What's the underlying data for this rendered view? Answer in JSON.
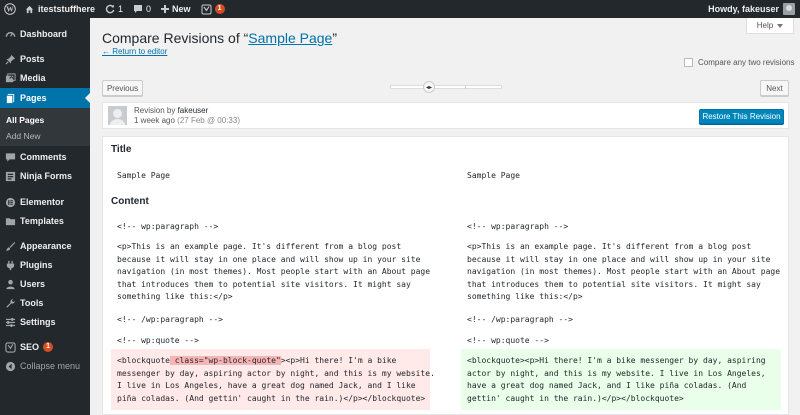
{
  "adminbar": {
    "site_name": "iteststuffhere",
    "updates_count": "1",
    "comments_count": "0",
    "new_label": "New",
    "plugin_badge": "1",
    "howdy": "Howdy, fakeuser"
  },
  "sidebar": {
    "items": [
      {
        "label": "Dashboard",
        "icon": "gauge-icon"
      },
      {
        "label": "Posts",
        "icon": "pin-icon"
      },
      {
        "label": "Media",
        "icon": "media-icon"
      },
      {
        "label": "Pages",
        "icon": "page-icon"
      },
      {
        "label": "Comments",
        "icon": "comment-icon"
      },
      {
        "label": "Ninja Forms",
        "icon": "forms-icon"
      },
      {
        "label": "Elementor",
        "icon": "elementor-icon"
      },
      {
        "label": "Templates",
        "icon": "folder-icon"
      },
      {
        "label": "Appearance",
        "icon": "brush-icon"
      },
      {
        "label": "Plugins",
        "icon": "plugin-icon"
      },
      {
        "label": "Users",
        "icon": "user-icon"
      },
      {
        "label": "Tools",
        "icon": "wrench-icon"
      },
      {
        "label": "Settings",
        "icon": "sliders-icon"
      },
      {
        "label": "SEO",
        "icon": "seo-icon",
        "badge": "1"
      },
      {
        "label": "Collapse menu",
        "icon": "collapse-icon"
      }
    ],
    "submenu": {
      "all_pages": "All Pages",
      "add_new": "Add New"
    }
  },
  "help_label": "Help",
  "header": {
    "title_prefix": "Compare Revisions of “",
    "page_link": "Sample Page",
    "title_suffix": "”",
    "return_link": "← Return to editor",
    "compare_two": "Compare any two revisions"
  },
  "nav": {
    "previous": "Previous",
    "next": "Next"
  },
  "revision": {
    "by_label": "Revision by ",
    "author": "fakeuser",
    "ago": "1 week ago",
    "timestamp": "(27 Feb @ 00:33)",
    "restore": "Restore This Revision"
  },
  "diff": {
    "title_heading": "Title",
    "title_left": "Sample Page",
    "title_right": "Sample Page",
    "content_heading": "Content",
    "left": {
      "wp_para_open": "<!-- wp:paragraph -->",
      "para": "<p>This is an example page. It's different from a blog post\nbecause it will stay in one place and will show up in your site\nnavigation (in most themes). Most people start with an About page\nthat introduces them to potential site visitors. It might say\nsomething like this:</p>",
      "wp_para_close": "<!-- /wp:paragraph -->",
      "wp_quote_open": "<!-- wp:quote -->",
      "quote_start": "<blockquote",
      "quote_deleted": " class=\"wp-block-quote\"",
      "quote_rest": "><p>Hi there! I'm a bike\nmessenger by day, aspiring actor by night, and this is my website.\nI live in Los Angeles, have a great dog named Jack, and I like\npiña coladas. (And gettin' caught in the rain.)</p></blockquote>"
    },
    "right": {
      "wp_para_open": "<!-- wp:paragraph -->",
      "para": "<p>This is an example page. It's different from a blog post\nbecause it will stay in one place and will show up in your site\nnavigation (in most themes). Most people start with an About page\nthat introduces them to potential site visitors. It might say\nsomething like this:</p>",
      "wp_para_close": "<!-- /wp:paragraph -->",
      "wp_quote_open": "<!-- wp:quote -->",
      "quote": "<blockquote><p>Hi there! I'm a bike messenger by day, aspiring\nactor by night, and this is my website. I live in Los Angeles,\nhave a great dog named Jack, and I like piña coladas. (And\ngettin' caught in the rain.)</p></blockquote>"
    }
  },
  "colors": {
    "accent": "#0073aa",
    "sidebar": "#23282d",
    "deleted": "#ffe9e9",
    "added": "#e9ffe9",
    "badge": "#d54e21"
  }
}
